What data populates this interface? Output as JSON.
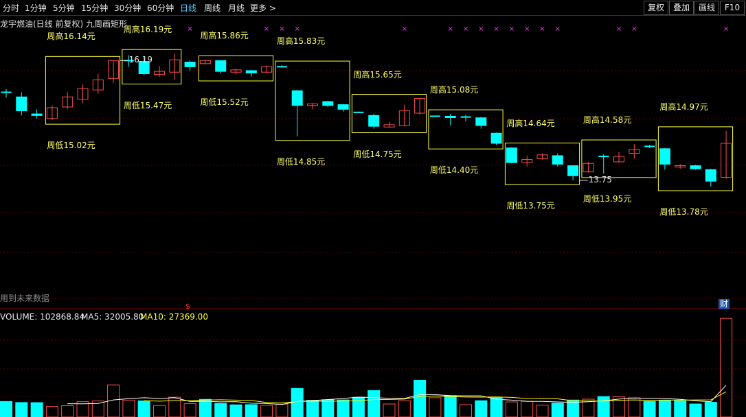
{
  "toolbar": {
    "periods": [
      "分时",
      "1分钟",
      "5分钟",
      "15分钟",
      "30分钟",
      "60分钟",
      "日线",
      "周线",
      "月线",
      "更多 >"
    ],
    "active_period": "日线",
    "buttons": [
      "复权",
      "叠加",
      "画线",
      "F10"
    ]
  },
  "chart_header": {
    "title": "龙宇燃油(日线 前复权) 九周画矩形"
  },
  "future_data_note": "用到未来数据",
  "volume_header": {
    "volume_label": "VOLUME: 102868.84",
    "ma5_label": "MA5: 32005.80",
    "ma10_label": "MA10: 27369.00"
  },
  "markers": {
    "finance_badge": "财",
    "dividend_mark": "$"
  },
  "colors": {
    "up": "#ff4d4d",
    "down": "#00ffff",
    "box": "#ffff33",
    "label": "#ffff66",
    "x_mark": "#ff33ff",
    "ma5": "#ffffff",
    "ma10": "#ffff00"
  },
  "chart_data": {
    "type": "candlestick",
    "price_axis_range": [
      13.3,
      16.45
    ],
    "volume_axis_max": 103000,
    "candles": [
      {
        "o": 15.62,
        "c": 15.62,
        "h": 15.66,
        "l": 15.55
      },
      {
        "o": 15.56,
        "c": 15.38,
        "h": 15.62,
        "l": 15.32
      },
      {
        "o": 15.34,
        "c": 15.32,
        "h": 15.4,
        "l": 15.28
      },
      {
        "o": 15.28,
        "c": 15.42,
        "h": 15.45,
        "l": 15.26
      },
      {
        "o": 15.43,
        "c": 15.56,
        "h": 15.62,
        "l": 15.4
      },
      {
        "o": 15.53,
        "c": 15.67,
        "h": 15.72,
        "l": 15.48
      },
      {
        "o": 15.65,
        "c": 15.78,
        "h": 15.86,
        "l": 15.6
      },
      {
        "o": 15.8,
        "c": 16.03,
        "h": 16.03,
        "l": 15.74
      },
      {
        "o": 16.03,
        "c": 16.03,
        "h": 16.1,
        "l": 15.95
      },
      {
        "o": 16.02,
        "c": 15.86,
        "h": 16.06,
        "l": 15.84
      },
      {
        "o": 15.85,
        "c": 15.89,
        "h": 15.96,
        "l": 15.82
      },
      {
        "o": 15.88,
        "c": 16.04,
        "h": 16.12,
        "l": 15.78
      },
      {
        "o": 16.01,
        "c": 15.95,
        "h": 16.03,
        "l": 15.9
      },
      {
        "o": 15.99,
        "c": 16.03,
        "h": 16.04,
        "l": 15.98
      },
      {
        "o": 16.03,
        "c": 15.89,
        "h": 16.03,
        "l": 15.86
      },
      {
        "o": 15.88,
        "c": 15.91,
        "h": 15.93,
        "l": 15.85
      },
      {
        "o": 15.9,
        "c": 15.87,
        "h": 15.91,
        "l": 15.82
      },
      {
        "o": 15.88,
        "c": 15.95,
        "h": 15.97,
        "l": 15.87
      },
      {
        "o": 15.95,
        "c": 15.95,
        "h": 15.97,
        "l": 15.94
      },
      {
        "o": 15.64,
        "c": 15.45,
        "h": 15.65,
        "l": 15.05
      },
      {
        "o": 15.45,
        "c": 15.47,
        "h": 15.48,
        "l": 15.4
      },
      {
        "o": 15.5,
        "c": 15.45,
        "h": 15.51,
        "l": 15.43
      },
      {
        "o": 15.46,
        "c": 15.4,
        "h": 15.47,
        "l": 15.37
      },
      {
        "o": 15.36,
        "c": 15.36,
        "h": 15.37,
        "l": 15.35
      },
      {
        "o": 15.32,
        "c": 15.18,
        "h": 15.34,
        "l": 15.15
      },
      {
        "o": 15.17,
        "c": 15.2,
        "h": 15.24,
        "l": 15.16
      },
      {
        "o": 15.19,
        "c": 15.38,
        "h": 15.46,
        "l": 15.18
      },
      {
        "o": 15.35,
        "c": 15.54,
        "h": 15.54,
        "l": 15.33
      },
      {
        "o": 15.31,
        "c": 15.31,
        "h": 15.32,
        "l": 15.3
      },
      {
        "o": 15.31,
        "c": 15.3,
        "h": 15.34,
        "l": 15.19
      },
      {
        "o": 15.3,
        "c": 15.3,
        "h": 15.33,
        "l": 15.24
      },
      {
        "o": 15.29,
        "c": 15.19,
        "h": 15.3,
        "l": 15.15
      },
      {
        "o": 15.09,
        "c": 14.96,
        "h": 15.1,
        "l": 14.94
      },
      {
        "o": 14.9,
        "c": 14.71,
        "h": 14.91,
        "l": 14.7
      },
      {
        "o": 14.71,
        "c": 14.75,
        "h": 14.8,
        "l": 14.66
      },
      {
        "o": 14.76,
        "c": 14.81,
        "h": 14.83,
        "l": 14.75
      },
      {
        "o": 14.8,
        "c": 14.69,
        "h": 14.83,
        "l": 14.66
      },
      {
        "o": 14.67,
        "c": 14.54,
        "h": 14.67,
        "l": 14.48
      },
      {
        "o": 14.59,
        "c": 14.7,
        "h": 14.72,
        "l": 14.58
      },
      {
        "o": 14.79,
        "c": 14.79,
        "h": 14.82,
        "l": 14.57
      },
      {
        "o": 14.72,
        "c": 14.79,
        "h": 14.85,
        "l": 14.71
      },
      {
        "o": 14.83,
        "c": 14.88,
        "h": 14.95,
        "l": 14.76
      },
      {
        "o": 14.92,
        "c": 14.92,
        "h": 14.94,
        "l": 14.9
      },
      {
        "o": 14.89,
        "c": 14.69,
        "h": 14.9,
        "l": 14.62
      },
      {
        "o": 14.66,
        "c": 14.67,
        "h": 14.69,
        "l": 14.63
      },
      {
        "o": 14.67,
        "c": 14.63,
        "h": 14.68,
        "l": 14.62
      },
      {
        "o": 14.62,
        "c": 14.47,
        "h": 14.63,
        "l": 14.4
      },
      {
        "o": 14.52,
        "c": 14.96,
        "h": 15.12,
        "l": 14.5
      }
    ],
    "volumes": [
      {
        "v": 16200,
        "up": false
      },
      {
        "v": 15100,
        "up": false
      },
      {
        "v": 15000,
        "up": false
      },
      {
        "v": 11000,
        "up": true
      },
      {
        "v": 11800,
        "up": true
      },
      {
        "v": 16000,
        "up": true
      },
      {
        "v": 16700,
        "up": true
      },
      {
        "v": 33500,
        "up": true
      },
      {
        "v": 17600,
        "up": true
      },
      {
        "v": 16800,
        "up": false
      },
      {
        "v": 12000,
        "up": true
      },
      {
        "v": 20600,
        "up": true
      },
      {
        "v": 13900,
        "up": true
      },
      {
        "v": 18400,
        "up": false
      },
      {
        "v": 14200,
        "up": false
      },
      {
        "v": 12700,
        "up": false
      },
      {
        "v": 12900,
        "up": false
      },
      {
        "v": 12100,
        "up": true
      },
      {
        "v": 13500,
        "up": true
      },
      {
        "v": 29800,
        "up": false
      },
      {
        "v": 17400,
        "up": false
      },
      {
        "v": 18000,
        "up": false
      },
      {
        "v": 17800,
        "up": false
      },
      {
        "v": 20600,
        "up": false
      },
      {
        "v": 27600,
        "up": false
      },
      {
        "v": 13600,
        "up": true
      },
      {
        "v": 16900,
        "up": true
      },
      {
        "v": 38300,
        "up": false
      },
      {
        "v": 20100,
        "up": true
      },
      {
        "v": 22300,
        "up": false
      },
      {
        "v": 12900,
        "up": true
      },
      {
        "v": 17000,
        "up": false
      },
      {
        "v": 20100,
        "up": false
      },
      {
        "v": 15700,
        "up": true
      },
      {
        "v": 16300,
        "up": true
      },
      {
        "v": 12300,
        "up": true
      },
      {
        "v": 14500,
        "up": false
      },
      {
        "v": 17700,
        "up": false
      },
      {
        "v": 18600,
        "up": true
      },
      {
        "v": 21300,
        "up": false
      },
      {
        "v": 21200,
        "up": true
      },
      {
        "v": 20000,
        "up": true
      },
      {
        "v": 16300,
        "up": false
      },
      {
        "v": 17600,
        "up": false
      },
      {
        "v": 16800,
        "up": false
      },
      {
        "v": 13600,
        "up": false
      },
      {
        "v": 15300,
        "up": false
      },
      {
        "v": 102868.84,
        "up": true
      }
    ],
    "ma5_level": 32005.8,
    "ma10_level": 27369.0,
    "weekly_boxes": [
      {
        "first": 3,
        "last": 7,
        "high_label": "周高16.14元",
        "low_label": "周低15.02元"
      },
      {
        "first": 8,
        "last": 11,
        "high_label": "周高16.19元",
        "low_label": "周低15.47元"
      },
      {
        "first": 13,
        "last": 17,
        "high_label": "周高15.86元",
        "low_label": "周低15.52元"
      },
      {
        "first": 18,
        "last": 22,
        "high_label": "周高15.83元",
        "low_label": "周低14.85元"
      },
      {
        "first": 23,
        "last": 27,
        "high_label": "周高15.65元",
        "low_label": "周低14.75元"
      },
      {
        "first": 28,
        "last": 32,
        "high_label": "周高15.08元",
        "low_label": "周低14.40元"
      },
      {
        "first": 33,
        "last": 37,
        "high_label": "周高14.64元",
        "low_label": "周低13.75元"
      },
      {
        "first": 38,
        "last": 42,
        "high_label": "周高14.58元",
        "low_label": "周低13.95元"
      },
      {
        "first": 43,
        "last": 47,
        "high_label": "周高14.97元",
        "low_label": "周低13.78元"
      }
    ],
    "x_marks": [
      12,
      17,
      18,
      19,
      26,
      29,
      30,
      31,
      32,
      33,
      34,
      35,
      36,
      40,
      41,
      47
    ],
    "max_label": "16.19",
    "min_label": "13.75",
    "max_index": 7,
    "min_index": 37
  }
}
